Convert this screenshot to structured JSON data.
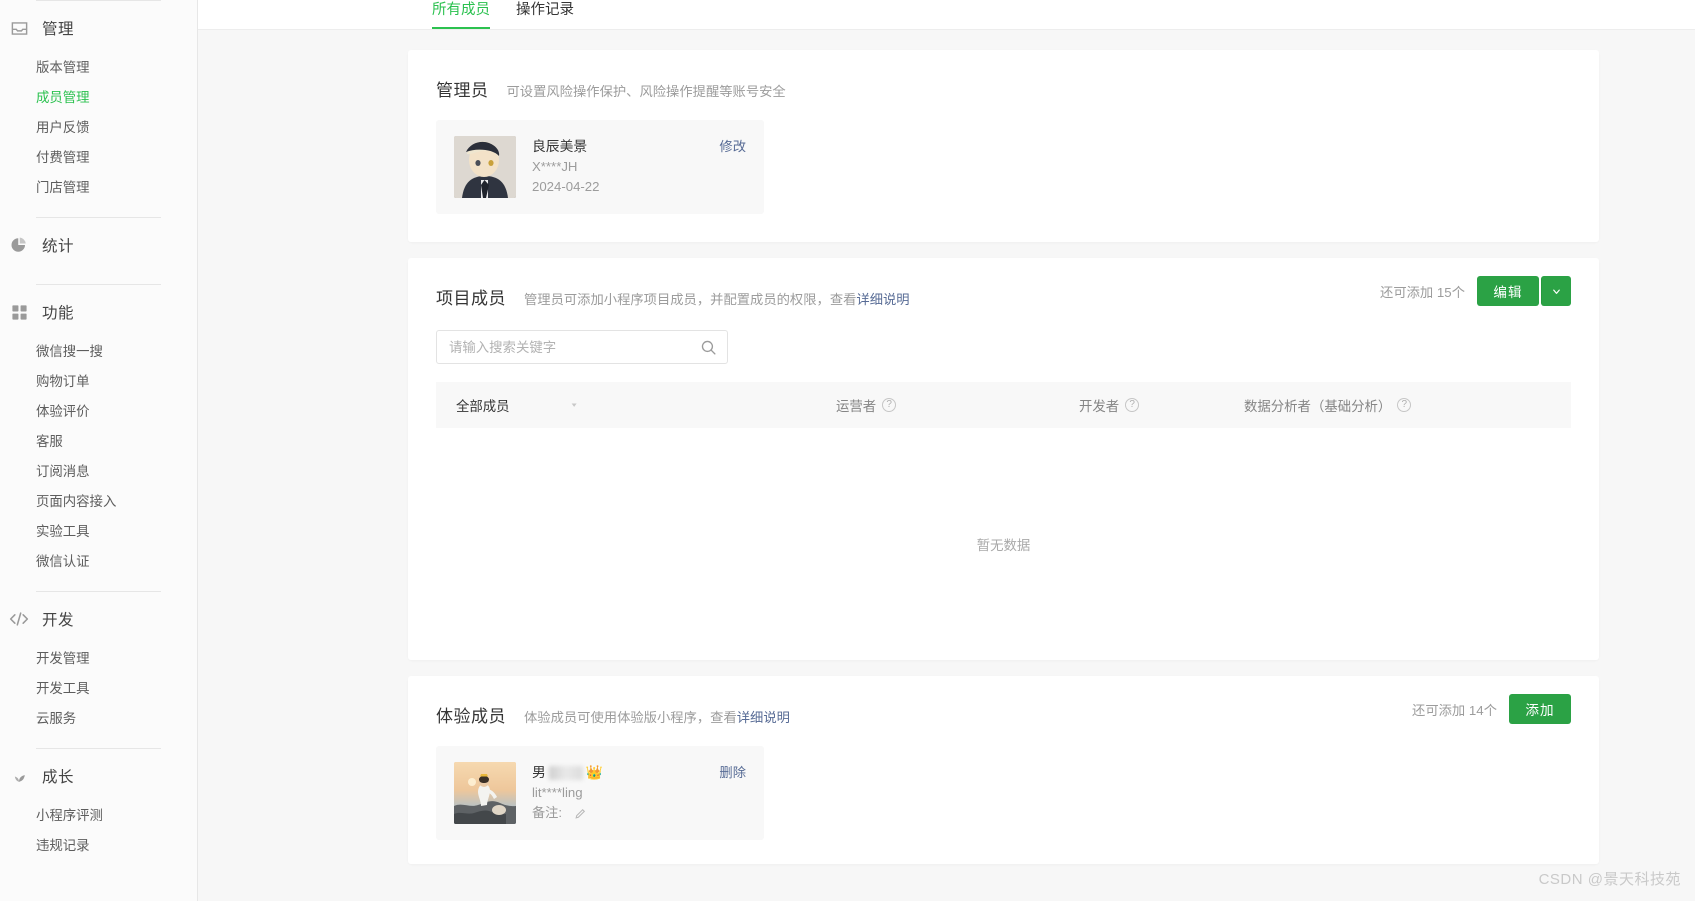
{
  "sidebar": {
    "groups": [
      {
        "icon": "inbox-icon",
        "title": "管理",
        "items": [
          {
            "label": "版本管理",
            "active": false
          },
          {
            "label": "成员管理",
            "active": true
          },
          {
            "label": "用户反馈",
            "active": false
          },
          {
            "label": "付费管理",
            "active": false
          },
          {
            "label": "门店管理",
            "active": false
          }
        ]
      },
      {
        "icon": "pie-chart-icon",
        "title": "统计",
        "items": []
      },
      {
        "icon": "grid-icon",
        "title": "功能",
        "items": [
          {
            "label": "微信搜一搜",
            "active": false
          },
          {
            "label": "购物订单",
            "active": false
          },
          {
            "label": "体验评价",
            "active": false
          },
          {
            "label": "客服",
            "active": false
          },
          {
            "label": "订阅消息",
            "active": false
          },
          {
            "label": "页面内容接入",
            "active": false
          },
          {
            "label": "实验工具",
            "active": false
          },
          {
            "label": "微信认证",
            "active": false
          }
        ]
      },
      {
        "icon": "code-icon",
        "title": "开发",
        "items": [
          {
            "label": "开发管理",
            "active": false
          },
          {
            "label": "开发工具",
            "active": false
          },
          {
            "label": "云服务",
            "active": false
          }
        ]
      },
      {
        "icon": "sprout-icon",
        "title": "成长",
        "items": [
          {
            "label": "小程序评测",
            "active": false
          },
          {
            "label": "违规记录",
            "active": false
          }
        ]
      }
    ]
  },
  "tabs": [
    {
      "label": "所有成员",
      "active": true
    },
    {
      "label": "操作记录",
      "active": false
    }
  ],
  "admin_section": {
    "title": "管理员",
    "desc": "可设置风险操作保护、风险操作提醒等账号安全",
    "member": {
      "name": "良辰美景",
      "account": "X****JH",
      "date": "2024-04-22",
      "action": "修改"
    }
  },
  "project_section": {
    "title": "项目成员",
    "desc_prefix": "管理员可添加小程序项目成员，并配置成员的权限，查看",
    "desc_link": "详细说明",
    "quota": "还可添加 15个",
    "edit_label": "编辑",
    "dropdown_icon": "chevron-down-icon",
    "search": {
      "placeholder": "请输入搜索关键字",
      "value": "",
      "icon": "search-icon"
    },
    "table": {
      "columns": [
        {
          "label": "全部成员",
          "help": false
        },
        {
          "label": "运营者",
          "help": true
        },
        {
          "label": "开发者",
          "help": true
        },
        {
          "label": "数据分析者（基础分析）",
          "help": true
        }
      ],
      "empty_text": "暂无数据",
      "rows": []
    }
  },
  "experience_section": {
    "title": "体验成员",
    "desc_prefix": "体验成员可使用体验版小程序，查看",
    "desc_link": "详细说明",
    "quota": "还可添加 14个",
    "add_label": "添加",
    "member": {
      "name_prefix": "男",
      "name_suffix": "👑",
      "account": "lit****ling",
      "remark_label": "备注:",
      "remark_icon": "pencil-icon",
      "action": "删除"
    }
  },
  "watermark": "CSDN @景天科技苑",
  "colors": {
    "accent": "#2bc14f",
    "button": "#2ba245",
    "link": "#576b95",
    "muted": "#9c9c9c"
  }
}
